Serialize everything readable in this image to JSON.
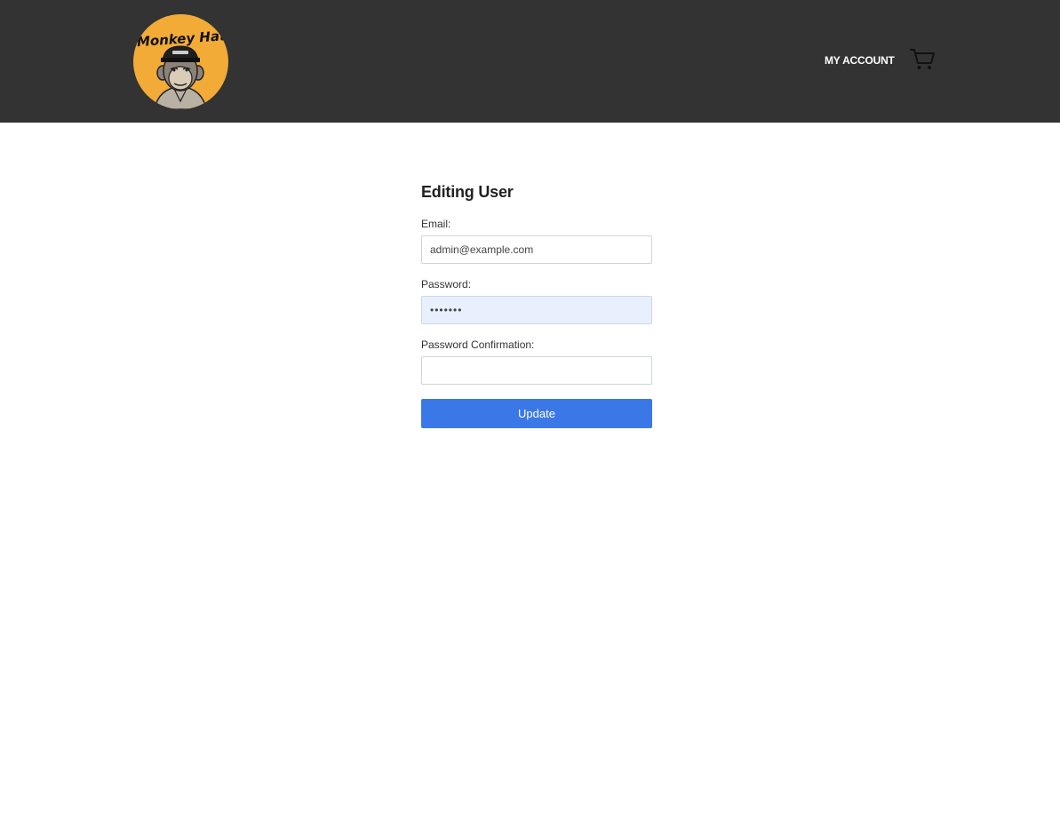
{
  "header": {
    "logo_text": "Monkey Hats",
    "account_link": "MY ACCOUNT",
    "cart_icon": "shopping-cart-icon"
  },
  "form": {
    "title": "Editing User",
    "email_label": "Email:",
    "email_value": "admin@example.com",
    "password_label": "Password:",
    "password_value": "1234567",
    "password_confirmation_label": "Password Confirmation:",
    "password_confirmation_value": "",
    "submit_label": "Update"
  },
  "colors": {
    "header_bg": "#333333",
    "logo_bg": "#f2ab37",
    "button_bg": "#3b78e7",
    "autofill_bg": "#e8f0fe"
  }
}
